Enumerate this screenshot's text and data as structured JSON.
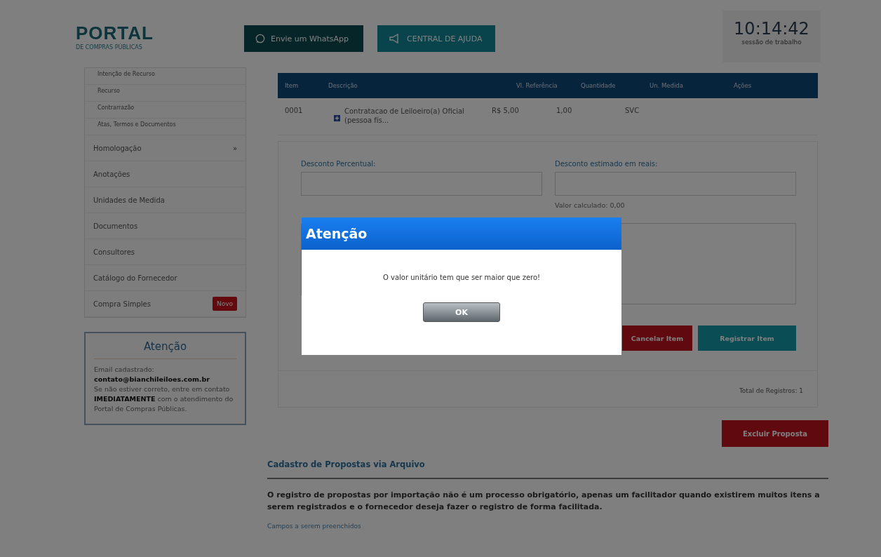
{
  "header": {
    "logo": "PORTAL",
    "logo_subtitle": "DE COMPRAS PÚBLICAS",
    "buttons": [
      {
        "kind": "whatsapp",
        "label": "Envie um WhatsApp"
      },
      {
        "kind": "help",
        "label": "CENTRAL DE AJUDA"
      }
    ],
    "clock": {
      "time": "10:14:42",
      "caption": "sessão de trabalho"
    }
  },
  "sidebar": {
    "subitems": [
      "Intenção de Recurso",
      "Recurso",
      "Contrarrazão",
      "Atas, Termos e Documentos"
    ],
    "items": [
      {
        "label": "Homologação",
        "toggle": "»"
      },
      {
        "label": "Anotações"
      },
      {
        "label": "Unidades de Medida"
      },
      {
        "label": "Documentos"
      },
      {
        "label": "Consultores"
      },
      {
        "label": "Catálogo do Fornecedor"
      },
      {
        "label": "Compra Simples",
        "badge": "Novo"
      }
    ],
    "notice": {
      "title": "Atenção",
      "label": "Email cadastrado:",
      "email": "contato@bianchileiloes.com.br",
      "text": "Se não estiver correto, entre em contato **IMEDIATAMENTE** com o atendimento do Portal de Compras Públicas."
    }
  },
  "table": {
    "columns": [
      "Item",
      "Descrição",
      "Vl. Referência",
      "Quantidade",
      "Un. Medida",
      "Ações"
    ],
    "rows": [
      {
        "cells": [
          "0001",
          "Contratacao de Leiloeiro(a) Oficial (pessoa fís...",
          "R$ 5,00",
          "1,00",
          "SVC"
        ]
      }
    ]
  },
  "form": {
    "discount_percent_label": "Desconto Percentual:",
    "discount_value_label": "Desconto estimado em reais:",
    "calculated": "Valor calculado: 0,00",
    "buttons": [
      {
        "kind": "cancel",
        "label": "Cancelar Item"
      },
      {
        "kind": "register",
        "label": "Registrar Item"
      }
    ]
  },
  "total": "Total de Registros: 1",
  "delete_button": "Excluir Proposta",
  "import": {
    "title": "Cadastro de Propostas via Arquivo",
    "text": "O registro de propostas por importação não é um processo obrigatório, apenas um facilitador quando existirem muitos itens a serem registrados e o fornecedor deseja fazer o registro de forma facilitada.",
    "link": "Campos a serem preenchidos"
  },
  "dialog": {
    "title": "Atenção",
    "message": "O valor unitário tem que ser maior que zero!",
    "button": "OK"
  }
}
